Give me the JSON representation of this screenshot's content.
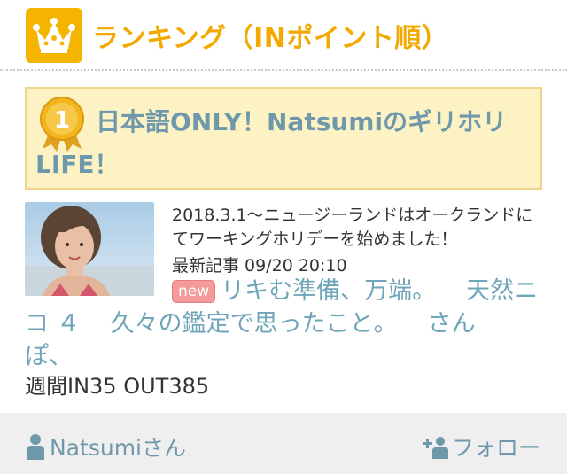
{
  "header": {
    "title": "ランキング（INポイント順）",
    "icon": "crown-icon",
    "accent_color": "#f5b400"
  },
  "ranking": {
    "rank": "1",
    "blog_title": "日本語ONLY！NatsumiのギリホリLIFE！",
    "avatar": "profile-photo"
  },
  "entry": {
    "description": "2018.3.1〜ニュージーランドはオークランドにてワーキングホリデーを始めました！",
    "latest_label": "最新記事 09/20 20:10",
    "new_badge": "new",
    "articles": [
      "リキむ準備、万端。",
      "天然ニコ ４",
      "久々の鑑定で思ったこと。",
      "さんぽ、"
    ],
    "stats": "週間IN35 OUT385"
  },
  "footer": {
    "user_label": "Natsumiさん",
    "follow_label": "フォロー"
  }
}
